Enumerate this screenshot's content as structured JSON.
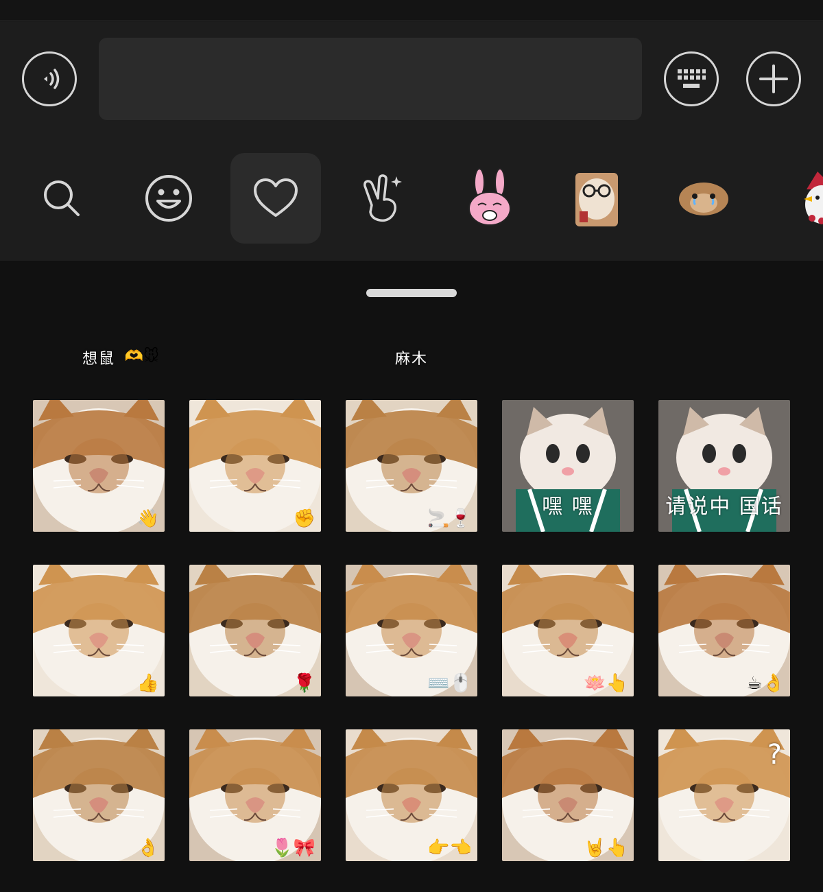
{
  "input_bar": {
    "voice_icon": "voice-input-icon",
    "keyboard_icon": "keyboard-icon",
    "plus_icon": "plus-icon",
    "text_value": ""
  },
  "sticker_tabs": [
    {
      "name": "search",
      "icon": "search-icon"
    },
    {
      "name": "emoji",
      "icon": "smiley-icon"
    },
    {
      "name": "favorites",
      "icon": "heart-icon",
      "active": true
    },
    {
      "name": "gesture",
      "icon": "victory-hand-icon"
    },
    {
      "name": "bunny-pack",
      "icon": "pink-bunny-icon"
    },
    {
      "name": "hamster-glasses-pack",
      "icon": "hamster-glasses-icon"
    },
    {
      "name": "crying-hamster-pack",
      "icon": "crying-hamster-icon"
    },
    {
      "name": "bird-pack",
      "icon": "bird-icon"
    }
  ],
  "stickers": {
    "row0": [
      {
        "caption": "想鼠",
        "deco": "🫶🐭"
      },
      {
        "caption": "",
        "deco": ""
      },
      {
        "caption": "麻木",
        "deco": ""
      },
      {
        "caption": "",
        "deco": ""
      },
      {
        "caption": "",
        "deco": ""
      }
    ],
    "row1": [
      {
        "caption": "",
        "deco": "👋"
      },
      {
        "caption": "",
        "deco": "✊"
      },
      {
        "caption": "",
        "deco": "🚬🍷"
      },
      {
        "caption": "嘿 嘿",
        "deco": ""
      },
      {
        "caption": "请说中 国话",
        "deco": ""
      }
    ],
    "row2": [
      {
        "caption": "",
        "deco": "👍"
      },
      {
        "caption": "",
        "deco": "🌹"
      },
      {
        "caption": "",
        "deco": "⌨️🖱️"
      },
      {
        "caption": "",
        "deco": "🪷👆"
      },
      {
        "caption": "",
        "deco": "☕👌"
      }
    ],
    "row3": [
      {
        "caption": "",
        "deco": "👌"
      },
      {
        "caption": "",
        "deco": "🌷🎀"
      },
      {
        "caption": "",
        "deco": "👉👈"
      },
      {
        "caption": "",
        "deco": "🤘👆"
      },
      {
        "caption": "?",
        "deco": ""
      }
    ]
  },
  "colors": {
    "background": "#111111",
    "panel": "#1d1d1d",
    "input_fill": "#2b2b2b",
    "icon_stroke": "#d6d6d6"
  }
}
